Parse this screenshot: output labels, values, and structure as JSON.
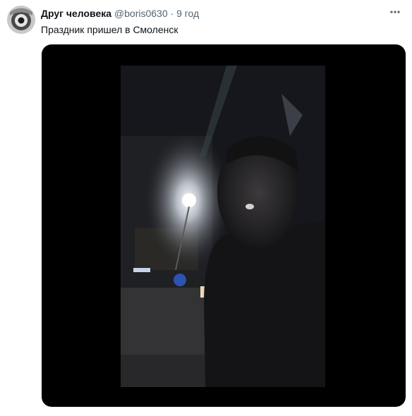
{
  "tweet": {
    "author_name": "Друг человека",
    "author_handle": "@boris0630",
    "separator": "·",
    "time": "9 год",
    "text": "Праздник пришел в Смоленск",
    "more_icon": "more-horizontal-icon"
  },
  "colors": {
    "name": "#0f1419",
    "secondary": "#536471",
    "media_bg": "#000000"
  }
}
